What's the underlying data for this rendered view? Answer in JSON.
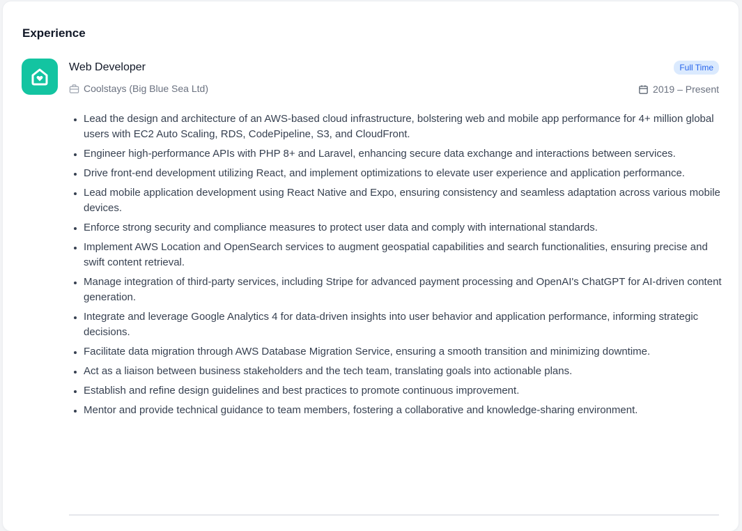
{
  "section": {
    "title": "Experience"
  },
  "job": {
    "title": "Web Developer",
    "company": "Coolstays (Big Blue Sea Ltd)",
    "type": "Full Time",
    "dates": "2019 – Present",
    "logo_icon": "home-heart-icon",
    "company_icon": "briefcase-icon",
    "dates_icon": "calendar-icon",
    "bullets": [
      "Lead the design and architecture of an AWS-based cloud infrastructure, bolstering web and mobile app performance for 4+ million global users with EC2 Auto Scaling, RDS, CodePipeline, S3, and CloudFront.",
      "Engineer high-performance APIs with PHP 8+ and Laravel, enhancing secure data exchange and interactions between services.",
      "Drive front-end development utilizing React, and implement optimizations to elevate user experience and application performance.",
      "Lead mobile application development using React Native and Expo, ensuring consistency and seamless adaptation across various mobile devices.",
      "Enforce strong security and compliance measures to protect user data and comply with international standards.",
      "Implement AWS Location and OpenSearch services to augment geospatial capabilities and search functionalities, ensuring precise and swift content retrieval.",
      "Manage integration of third-party services, including Stripe for advanced payment processing and OpenAI's ChatGPT for AI-driven content generation.",
      "Integrate and leverage Google Analytics 4 for data-driven insights into user behavior and application performance, informing strategic decisions.",
      "Facilitate data migration through AWS Database Migration Service, ensuring a smooth transition and minimizing downtime.",
      "Act as a liaison between business stakeholders and the tech team, translating goals into actionable plans.",
      "Establish and refine design guidelines and best practices to promote continuous improvement.",
      "Mentor and provide technical guidance to team members, fostering a collaborative and knowledge-sharing environment."
    ]
  },
  "colors": {
    "logo_bg": "#13c4a1",
    "badge_bg": "#dbeafe",
    "badge_text": "#2563eb"
  }
}
